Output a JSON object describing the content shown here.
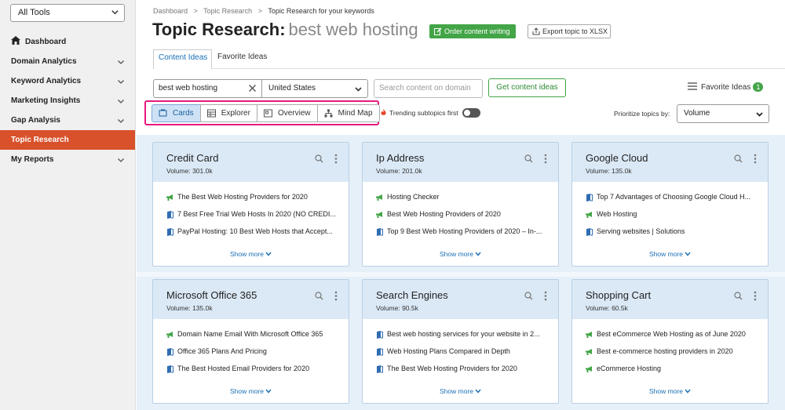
{
  "sidebar": {
    "tools_select": "All Tools",
    "items": [
      {
        "label": "Dashboard"
      },
      {
        "label": "Domain Analytics"
      },
      {
        "label": "Keyword Analytics"
      },
      {
        "label": "Marketing Insights"
      },
      {
        "label": "Gap Analysis"
      },
      {
        "label": "Topic Research"
      },
      {
        "label": "My Reports"
      }
    ]
  },
  "breadcrumb": [
    "Dashboard",
    ">",
    "Topic Research",
    ">",
    "Topic Research for your keywords"
  ],
  "page": {
    "title": "Topic Research:",
    "keyword": "best web hosting",
    "order_button": "Order content writing",
    "export_button": "Export topic to XLSX"
  },
  "tabs": {
    "content_ideas": "Content Ideas",
    "favorite_ideas": "Favorite Ideas"
  },
  "search": {
    "keyword_value": "best web hosting",
    "country": "United States",
    "content_placeholder": "Search content on domain",
    "get_button": "Get content ideas"
  },
  "favorites": {
    "label": "Favorite Ideas",
    "count": "1"
  },
  "views": {
    "cards": "Cards",
    "explorer": "Explorer",
    "overview": "Overview",
    "mind_map": "Mind Map"
  },
  "trending": {
    "label": "Trending subtopics first"
  },
  "prioritize": {
    "label": "Prioritize topics by:",
    "value": "Volume"
  },
  "cards": [
    {
      "title": "Credit Card",
      "volume": "Volume:  301.0k",
      "items": [
        "The Best Web Hosting Providers for 2020",
        "7 Best Free Trial Web Hosts In 2020 (NO CREDI...",
        "PayPal Hosting: 10 Best Web Hosts that Accept..."
      ],
      "show_more": "Show more"
    },
    {
      "title": "Ip Address",
      "volume": "Volume:  201.0k",
      "items": [
        "Hosting Checker",
        "Best Web Hosting Providers of 2020",
        "Top 9 Best Web Hosting Providers of 2020 – In-..."
      ],
      "show_more": "Show more"
    },
    {
      "title": "Google Cloud",
      "volume": "Volume:  135.0k",
      "items": [
        "Top 7 Advantages of Choosing Google Cloud H...",
        "Web Hosting",
        "Serving websites | Solutions"
      ],
      "show_more": "Show more"
    },
    {
      "title": "Microsoft Office 365",
      "volume": "Volume:  135.0k",
      "items": [
        "Domain Name Email With Microsoft Office 365",
        "Office 365 Plans And Pricing",
        "The Best Hosted Email Providers for 2020"
      ],
      "show_more": "Show more"
    },
    {
      "title": "Search Engines",
      "volume": "Volume:  90.5k",
      "items": [
        "Best web hosting services for your website in 2...",
        "Web Hosting Plans Compared in Depth",
        "The Best Web Hosting Providers for 2020"
      ],
      "show_more": "Show more"
    },
    {
      "title": "Shopping Cart",
      "volume": "Volume:  60.5k",
      "items": [
        "Best eCommerce Web Hosting as of June 2020",
        "Best e-commerce hosting providers in 2020",
        "eCommerce Hosting"
      ],
      "show_more": "Show more"
    }
  ],
  "colors": {
    "accent_orange": "#d8512a",
    "green": "#43a547",
    "highlight_pink": "#e8187d",
    "link_blue": "#1a6fb5"
  }
}
